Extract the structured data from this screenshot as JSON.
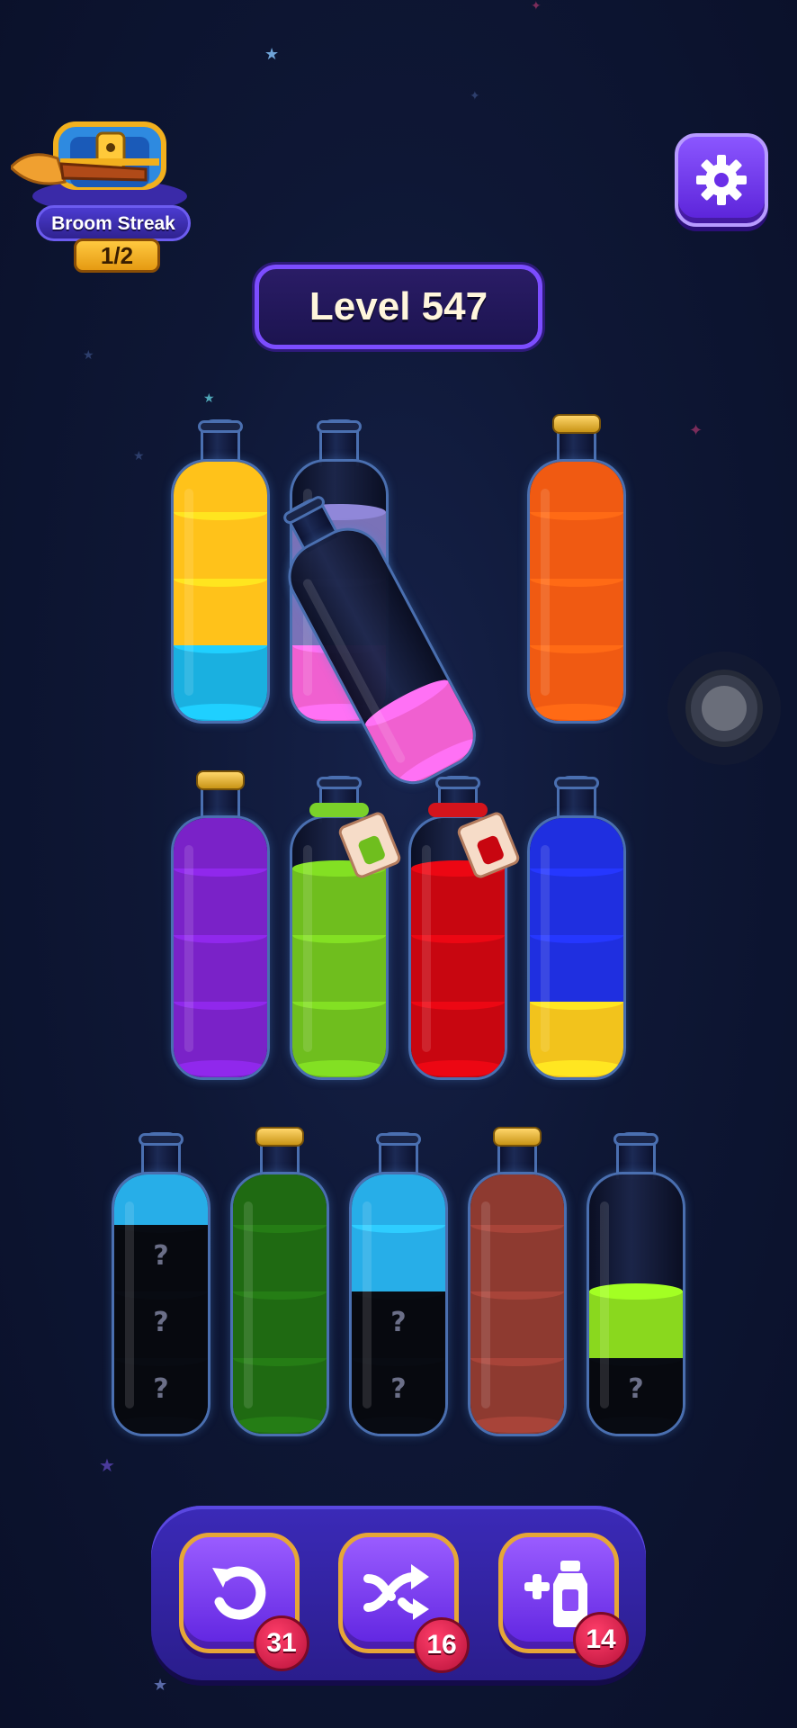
{
  "streak": {
    "label": "Broom Streak",
    "count": "1/2",
    "icon": "treasure-chest-broom"
  },
  "settings": {
    "icon": "gear-icon"
  },
  "level": {
    "label": "Level 547"
  },
  "bottles": {
    "row1": [
      {
        "layers": [
          "#1ab0e0",
          "#ffc21a",
          "#ffc21a",
          "#ffc21a"
        ],
        "capped": false
      },
      {
        "layers": [
          "#f060d0",
          "#7a72b8",
          "#7a72b8"
        ],
        "capped": false
      },
      {
        "layers": [
          "#f060d0"
        ],
        "capped": false,
        "tilted": true
      },
      {
        "layers": [
          "#f05a12",
          "#f05a12",
          "#f05a12",
          "#f05a12"
        ],
        "capped": true
      }
    ],
    "row2": [
      {
        "layers": [
          "#7a22c8",
          "#7a22c8",
          "#7a22c8",
          "#7a22c8"
        ],
        "capped": true
      },
      {
        "layers": [
          "#6fbe1e",
          "#6fbe1e",
          "#6fbe1e"
        ],
        "capped": false,
        "tied": "green"
      },
      {
        "layers": [
          "#c80610",
          "#c80610",
          "#c80610"
        ],
        "capped": false,
        "tied": "red"
      },
      {
        "layers": [
          "#f2c31c",
          "#1f2fe0",
          "#1f2fe0",
          "#1f2fe0"
        ],
        "capped": false
      }
    ],
    "row3": [
      {
        "layers": [
          "hidden",
          "hidden",
          "hidden",
          "#27aee8"
        ],
        "capped": false
      },
      {
        "layers": [
          "#1f6a12",
          "#1f6a12",
          "#1f6a12",
          "#1f6a12"
        ],
        "capped": true
      },
      {
        "layers": [
          "hidden",
          "hidden",
          "#27aee8",
          "#27aee8"
        ],
        "capped": false
      },
      {
        "layers": [
          "#8e3a30",
          "#8e3a30",
          "#8e3a30",
          "#8e3a30"
        ],
        "capped": true
      },
      {
        "layers": [
          "hidden",
          "#8ad81e"
        ],
        "capped": false
      }
    ]
  },
  "hidden_marker": "?",
  "powerups": [
    {
      "name": "undo",
      "icon": "undo-icon",
      "count": "31"
    },
    {
      "name": "shuffle",
      "icon": "shuffle-icon",
      "count": "16"
    },
    {
      "name": "add-bottle",
      "icon": "add-bottle-icon",
      "count": "14"
    }
  ]
}
